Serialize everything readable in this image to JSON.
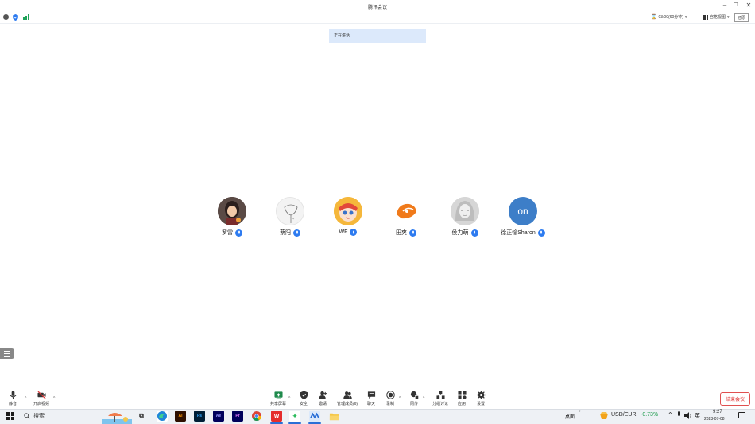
{
  "window": {
    "title": "腾讯会议",
    "tooltip": "还原"
  },
  "header": {
    "timer": "03:00(60分钟)",
    "view_label": "宫格视图"
  },
  "banner": {
    "text": "正在讲话:"
  },
  "participants": [
    {
      "name": "罗雷"
    },
    {
      "name": "蔡阳"
    },
    {
      "name": "WF"
    },
    {
      "name": "田爽"
    },
    {
      "name": "侯力萌"
    },
    {
      "name": "徐正愉Sharon",
      "avatar_text": "on"
    }
  ],
  "toolbar": {
    "mute": "静音",
    "video": "开启视频",
    "share": "共享屏幕",
    "security": "安全",
    "invite": "邀请",
    "members": "管理成员(6)",
    "chat": "聊天",
    "record": "录制",
    "interpret": "同传",
    "breakout": "分组讨论",
    "apps": "应用",
    "settings": "设置",
    "end": "结束会议"
  },
  "taskbar": {
    "search": "搜索",
    "desktop": "桌面",
    "ticker_name": "USD/EUR",
    "ticker_change": "-0.73%",
    "ime": "英",
    "time": "9:27",
    "date": "2023-07-08"
  },
  "colors": {
    "accent": "#2d7bf0",
    "end_red": "#e03a3a",
    "ticker_green": "#1a9a4a",
    "banner_bg": "#dce9fb"
  }
}
